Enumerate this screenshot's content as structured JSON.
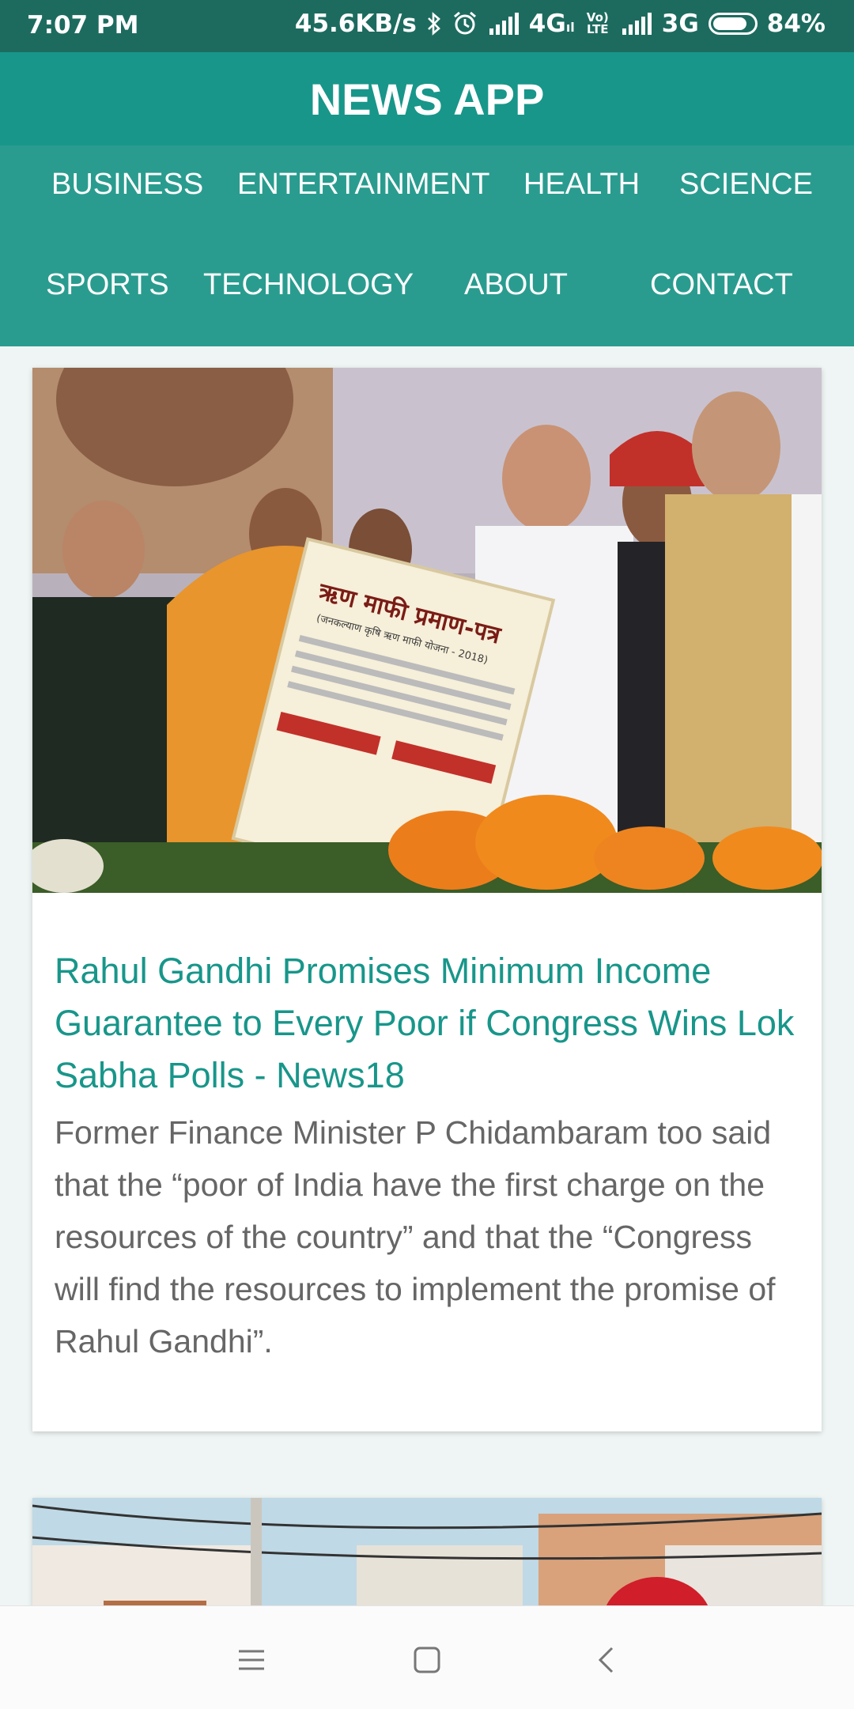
{
  "status_bar": {
    "time": "7:07 PM",
    "network_speed": "45.6KB/s",
    "network_1": "4G",
    "network_1_sub": "ıl",
    "volte": "Vo) LTE",
    "network_2": "3G",
    "battery": "84%",
    "battery_level": 0.84,
    "icons": [
      "bluetooth-icon",
      "alarm-icon",
      "signal-icon",
      "volte-icon",
      "battery-icon"
    ]
  },
  "header": {
    "title": "NEWS APP"
  },
  "categories": [
    {
      "label": "BUSINESS"
    },
    {
      "label": "ENTERTAINMENT"
    },
    {
      "label": "HEALTH"
    },
    {
      "label": "SCIENCE"
    },
    {
      "label": "SPORTS"
    },
    {
      "label": "TECHNOLOGY"
    },
    {
      "label": "ABOUT"
    },
    {
      "label": "CONTACT"
    }
  ],
  "articles": [
    {
      "title": "Rahul Gandhi Promises Minimum Income Guarantee to Every Poor if Congress Wins Lok Sabha Polls - News18",
      "description": "Former Finance Minister P Chidambaram too said that the “poor of India have the first charge on the resources of the country” and that the “Congress will find the resources to implement the promise of Rahul Gandhi”.",
      "image_signboard_line1": "ऋण माफी प्रमाण-पत्र",
      "image_signboard_line2": "(जनकल्याण कृषि ऋण माफी योजना - 2018)"
    },
    {
      "title": "",
      "description": ""
    }
  ],
  "bottom_nav": {
    "icons": [
      "menu-icon",
      "home-square-icon",
      "back-chevron-icon"
    ]
  },
  "colors": {
    "status_bar": "#1d6b5f",
    "header": "#18968a",
    "nav": "#2a9c8f",
    "title": "#18968a",
    "description": "#666666",
    "background": "#eef5f4"
  }
}
